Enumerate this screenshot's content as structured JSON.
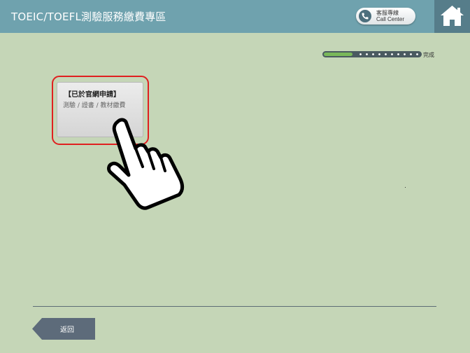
{
  "header": {
    "title": "TOEIC/TOEFL測驗服務繳費專區",
    "call_center": {
      "line1": "客服專線",
      "line2": "Call Center",
      "icon": "phone-icon"
    },
    "home_icon": "home-icon"
  },
  "progress": {
    "label": "完成",
    "fraction": 0.3
  },
  "option": {
    "title": "【已於官網申請】",
    "subtitle": "測驗 / 證書 / 教材繳費"
  },
  "cursor_icon": "hand-pointer-icon",
  "footer": {
    "back_label": "返回"
  },
  "colors": {
    "background": "#c5d6b7",
    "header": "#6fa2ae",
    "highlight": "#e02020",
    "back_button": "#5d6b7a",
    "progress": "#7ab85a"
  }
}
